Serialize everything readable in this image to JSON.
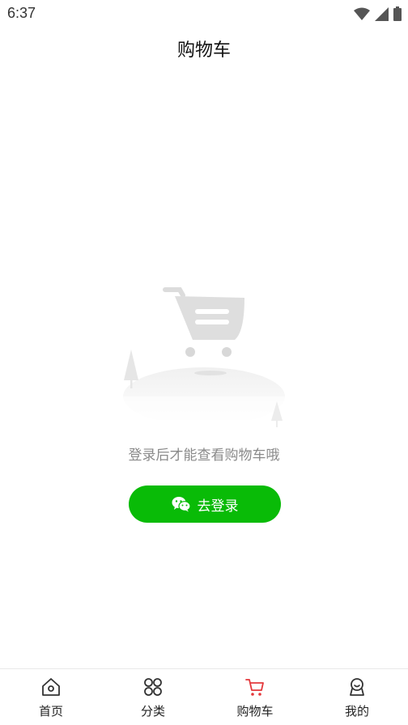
{
  "status_bar": {
    "time": "6:37"
  },
  "header": {
    "title": "购物车"
  },
  "empty_state": {
    "message": "登录后才能查看购物车哦",
    "login_button_label": "去登录"
  },
  "tabbar": {
    "tabs": [
      {
        "label": "首页",
        "icon": "home-icon"
      },
      {
        "label": "分类",
        "icon": "category-grid-icon"
      },
      {
        "label": "购物车",
        "icon": "cart-icon",
        "active": true
      },
      {
        "label": "我的",
        "icon": "profile-icon"
      }
    ]
  },
  "colors": {
    "accent_green": "#09bb07",
    "active_tab_icon": "#e4393c",
    "muted_text": "#8a8a8a"
  }
}
